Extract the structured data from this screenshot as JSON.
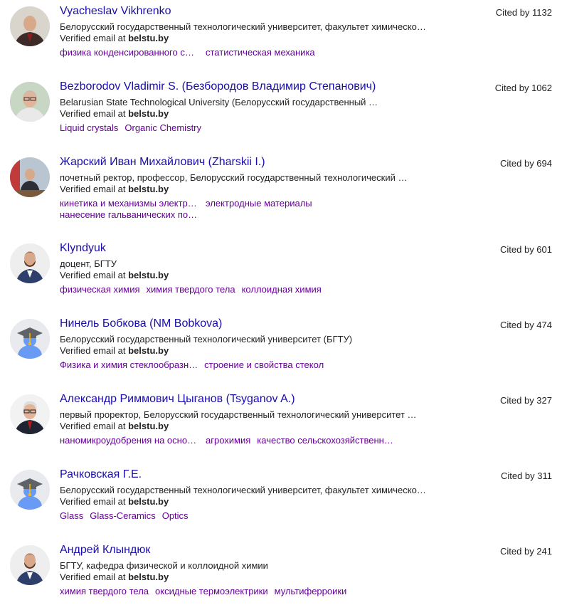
{
  "profiles": [
    {
      "name": "Vyacheslav Vikhrenko",
      "cited": "Cited by 1132",
      "affiliation": "Белорусский государственный технологический университет, факультет химической …",
      "email_prefix": "Verified email at ",
      "email_domain": "belstu.by",
      "avatar": "photo-man-suit",
      "tags": [
        "физика конденсированного со…",
        "статистическая механика"
      ]
    },
    {
      "name": "Bezborodov Vladimir S. (Безбородов Владимир Степанович)",
      "cited": "Cited by 1062",
      "affiliation": "Belarusian State Technological University (Белорусский государственный …",
      "email_prefix": "Verified email at ",
      "email_domain": "belstu.by",
      "avatar": "photo-man-glasses",
      "tags": [
        "Liquid crystals",
        "Organic Chemistry"
      ]
    },
    {
      "name": "Жарский Иван Михайлович (Zharskii I.)",
      "cited": "Cited by 694",
      "affiliation": "почетный ректор, профессор, Белорусский государственный технологический …",
      "email_prefix": "Verified email at ",
      "email_domain": "belstu.by",
      "avatar": "photo-man-desk",
      "tags": [
        "кинетика и механизмы электро…",
        "электродные материалы",
        "нанесение гальванических пок…"
      ]
    },
    {
      "name": "Klyndyuk",
      "cited": "Cited by 601",
      "affiliation": "доцент, БГТУ",
      "email_prefix": "Verified email at ",
      "email_domain": "belstu.by",
      "avatar": "photo-man-beard",
      "tags": [
        "физическая химия",
        "химия твердого тела",
        "коллоидная химия"
      ]
    },
    {
      "name": "Нинель Бобкова (NM Bobkova)",
      "cited": "Cited by 474",
      "affiliation": "Белорусский государственный технологический университет (БГТУ)",
      "email_prefix": "Verified email at ",
      "email_domain": "belstu.by",
      "avatar": "default-graduate",
      "tags": [
        "Физика и химия стеклообразн…",
        "строение и свойства стекол"
      ]
    },
    {
      "name": "Александр Риммович Цыганов (Tsyganov A.)",
      "cited": "Cited by 327",
      "affiliation": "первый проректор, Белорусский государственный технологический университет …",
      "email_prefix": "Verified email at ",
      "email_domain": "belstu.by",
      "avatar": "photo-man-white-hair",
      "tags": [
        "наномикроудобрения на основ…",
        "агрохимия",
        "качество сельскохозяйственно…"
      ]
    },
    {
      "name": "Рачковская Г.Е.",
      "cited": "Cited by 311",
      "affiliation": "Белорусский государственный технологический университет, факультет химической …",
      "email_prefix": "Verified email at ",
      "email_domain": "belstu.by",
      "avatar": "default-graduate",
      "tags": [
        "Glass",
        "Glass-Ceramics",
        "Optics"
      ]
    },
    {
      "name": "Андрей Клындюк",
      "cited": "Cited by 241",
      "affiliation": "БГТУ, кафедра физической и коллоидной химии",
      "email_prefix": "Verified email at ",
      "email_domain": "belstu.by",
      "avatar": "photo-man-beard",
      "tags": [
        "химия твердого тела",
        "оксидные термоэлектрики",
        "мультиферроики"
      ]
    }
  ],
  "colors": {
    "name_link": "#1a0dab",
    "tag_link": "#660099",
    "default_avatar_bg": "#e8eaed",
    "default_avatar_body": "#6a9bf4",
    "default_avatar_cap": "#5f6368",
    "tassel": "#fbbc04"
  }
}
